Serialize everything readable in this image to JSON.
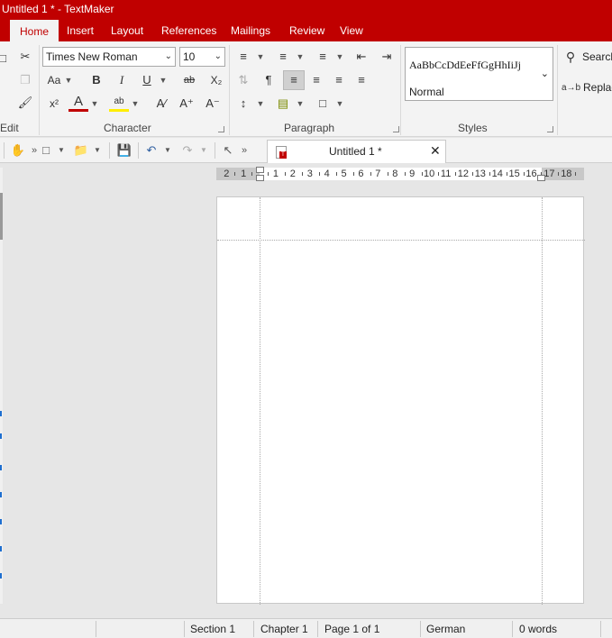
{
  "window": {
    "title": "Untitled 1 * - TextMaker"
  },
  "tabs": [
    "Home",
    "Insert",
    "Layout",
    "References",
    "Mailings",
    "Review",
    "View"
  ],
  "active_tab": "Home",
  "ribbon": {
    "groups": {
      "edit": "Edit",
      "character": "Character",
      "paragraph": "Paragraph",
      "styles": "Styles"
    },
    "font_name": "Times New Roman",
    "font_size": "10",
    "style_preview": "AaBbCcDdEeFfGgHhIiJj",
    "style_name": "Normal",
    "search_label": "Search",
    "replace_label": "Replac",
    "bold": "B",
    "italic": "I",
    "underline": "U",
    "strike": "ab",
    "subscript": "X₂",
    "superscript": "x²",
    "font_color": "A",
    "highlight": "ab",
    "grow": "A⁺",
    "shrink": "A⁻"
  },
  "document_tab": {
    "name": "Untitled 1 *",
    "close": "✕"
  },
  "ruler": {
    "left_labels": [
      "2",
      "1"
    ],
    "labels": [
      "1",
      "2",
      "3",
      "4",
      "5",
      "6",
      "7",
      "8",
      "9",
      "10",
      "11",
      "12",
      "13",
      "14",
      "15",
      "16"
    ],
    "right_labels": [
      "17",
      "18"
    ]
  },
  "status": {
    "section": "Section 1",
    "chapter": "Chapter 1",
    "page": "Page 1 of 1",
    "language": "German",
    "words": "0 words"
  },
  "colors": {
    "accent": "#c00000",
    "font_color_bar": "#c00000",
    "highlight_bar": "#ffee00"
  }
}
